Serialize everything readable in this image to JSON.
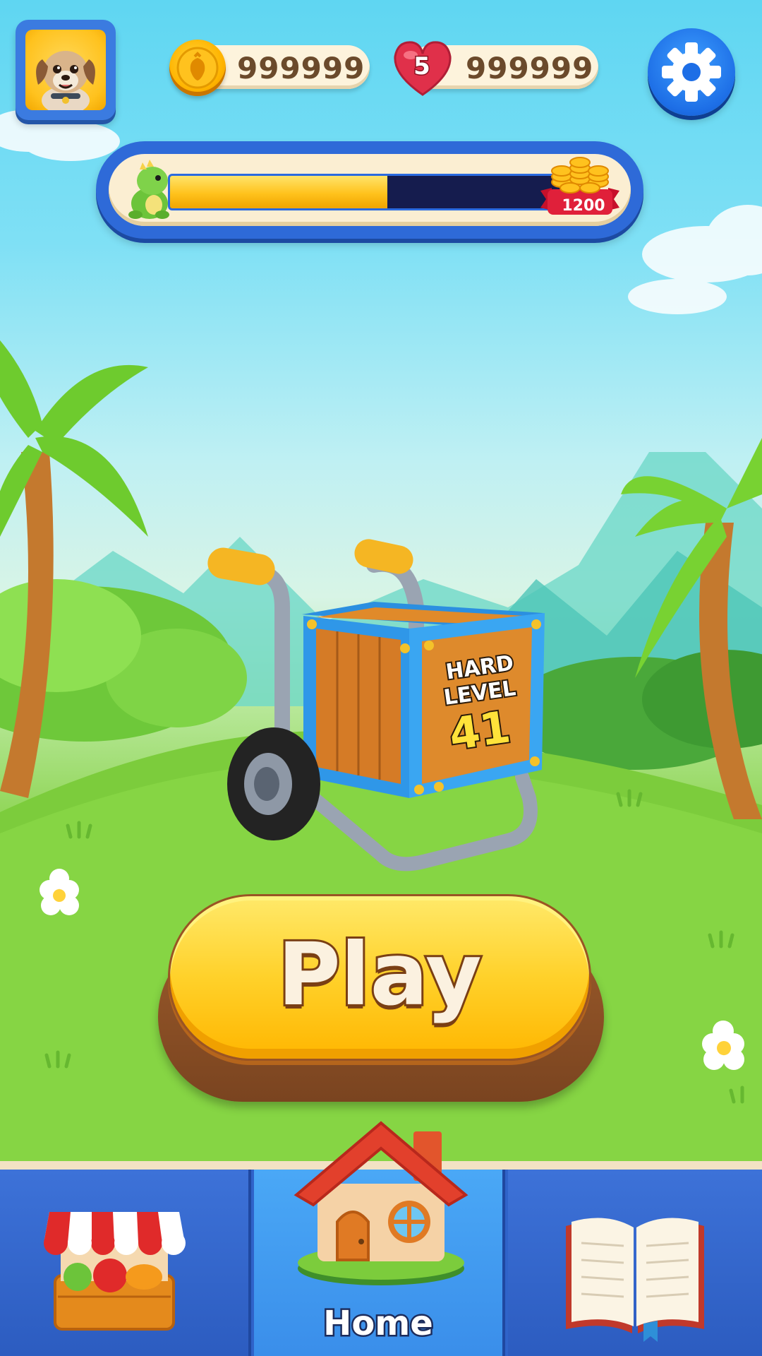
{
  "hud": {
    "coins": "999999",
    "lives_count": "5",
    "lives_total": "999999"
  },
  "progress": {
    "fraction": 0.55,
    "reward": "1200"
  },
  "level": {
    "difficulty": "HARD",
    "label": "LEVEL",
    "number": "41"
  },
  "play_label": "Play",
  "nav": {
    "shop_icon": "shop-stall-icon",
    "home_icon": "house-icon",
    "home_label": "Home",
    "book_icon": "open-book-icon"
  },
  "colors": {
    "accent_blue": "#2f63c9",
    "play_yellow": "#ffd12a",
    "progress_track": "#151c4e"
  }
}
